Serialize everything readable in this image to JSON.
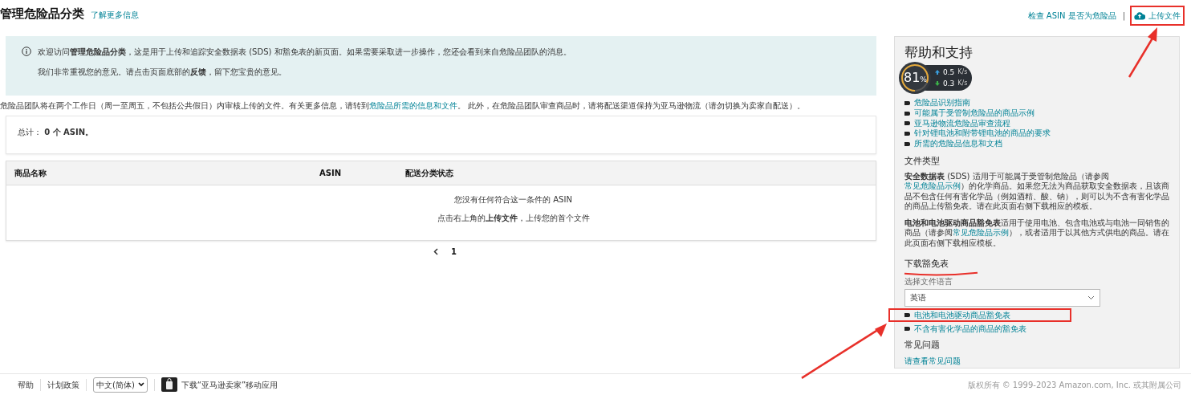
{
  "header": {
    "title": "管理危险品分类",
    "learn_more": "了解更多信息",
    "check_link": "检查 ASIN 是否为危险品",
    "separator": "|",
    "upload": "上传文件"
  },
  "notice": {
    "lines": [
      "欢迎访问**管理危险品分类**，这是用于上传和追踪安全数据表 (SDS) 和豁免表的新页面。如果需要采取进一步操作，您还会看到来自危险品团队的消息。",
      "我们非常重视您的意见。请点击页面底部的**反馈**，留下您宝贵的意见。"
    ]
  },
  "review_note": [
    {
      "text": "危险品团队将在两个工作日（周一至周五，不包括公共假日）内审核上传的文件。有关更多信息，请转到",
      "kind": "text"
    },
    {
      "text": "危险品所需的信息和文件",
      "kind": "link"
    },
    {
      "text": "。 此外，在危险品团队审查商品时，请将配送渠道保持为亚马逊物流（请勿切换为卖家自配送）。",
      "kind": "text"
    }
  ],
  "summary": "总计： **0 个 ASIN。**",
  "table": {
    "columns": [
      "商品名称",
      "ASIN",
      "配送分类状态"
    ],
    "empty_lines": [
      "您没有任何符合这一条件的 ASIN",
      "点击右上角的**上传文件**，上传您的首个文件"
    ]
  },
  "pagination": {
    "pages": [
      {
        "label": "1",
        "selected": true
      }
    ]
  },
  "sidebar": {
    "title": "帮助和支持",
    "links": [
      "危险品识别指南",
      "可能属于受管制危险品的商品示例",
      "亚马逊物流危险品审查流程",
      "针对锂电池和附带锂电池的商品的要求",
      "所需的危险品信息和文档"
    ],
    "file_types": {
      "heading": "文件类型",
      "paragraphs": [
        [
          {
            "text": "**安全数据表** (SDS) 适用于可能属于受管制危险品（请参阅",
            "kind": "text"
          },
          {
            "text": "常见危险品示例",
            "kind": "link"
          },
          {
            "text": "）的化学商品。如果您无法为商品获取安全数据表，且该商品不包含任何有害化学品（例如酒精、酸、钠），则可以为不含有害化学品的商品上传豁免表。请在此页面右侧下载相应的模板。",
            "kind": "text"
          }
        ],
        [
          {
            "text": "**电池和电池驱动商品豁免表**适用于使用电池、包含电池或与电池一同销售的商品（请参阅",
            "kind": "text"
          },
          {
            "text": "常见危险品示例",
            "kind": "link"
          },
          {
            "text": "），或者适用于以其他方式供电的商品。请在此页面右侧下载相应模板。",
            "kind": "text"
          }
        ]
      ]
    },
    "download": {
      "heading": "下载豁免表",
      "language_label": "选择文件语言",
      "language": "英语",
      "links": [
        "电池和电池驱动商品豁免表",
        "不含有害化学品的商品的豁免表"
      ]
    },
    "faq": {
      "heading": "常见问题",
      "link": "请查看常见问题"
    }
  },
  "footer": {
    "links": [
      "帮助",
      "计划政策"
    ],
    "language": "中文(简体)",
    "app_link": "下载“亚马逊卖家”移动应用",
    "copyright": "版权所有 © 1999-2023 Amazon.com, Inc. 或其附属公司"
  },
  "speed_widget": {
    "percent": "81",
    "unit": "%",
    "level": 0.81,
    "upload": "0.5",
    "upload_unit": "K/s",
    "download": "0.3",
    "download_unit": "K/s"
  }
}
